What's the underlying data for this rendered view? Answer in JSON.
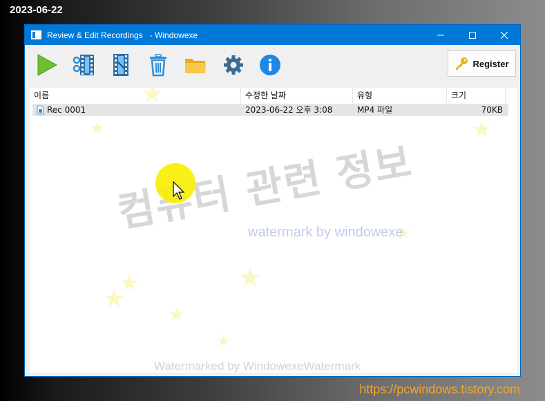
{
  "overlay": {
    "date": "2023-06-22",
    "url": "https://pcwindows.tistory.com"
  },
  "window": {
    "title": "Review & Edit Recordings   - Windowexe",
    "minimize_icon": "minimize-icon",
    "maximize_icon": "maximize-icon",
    "close_icon": "close-icon"
  },
  "toolbar": {
    "buttons": [
      {
        "icon": "play-icon"
      },
      {
        "icon": "film-join-icon"
      },
      {
        "icon": "film-cut-icon"
      },
      {
        "icon": "trash-icon"
      },
      {
        "icon": "folder-icon"
      },
      {
        "icon": "gear-icon"
      },
      {
        "icon": "info-icon"
      }
    ],
    "register_label": "Register",
    "register_icon": "key-icon"
  },
  "list": {
    "columns": [
      "이름",
      "수정한 날짜",
      "유형",
      "크기"
    ],
    "rows": [
      {
        "name": "Rec 0001",
        "modified": "2023-06-22 오후 3:08",
        "type": "MP4 파일",
        "size": "70KB"
      }
    ]
  },
  "watermarks": {
    "main": "컴퓨터 관련 정보",
    "sub": "watermark by windowexe",
    "bottom": "Watermarked by WindowexeWatermark"
  },
  "colors": {
    "titlebar": "#0078d7",
    "play": "#6fbf2e",
    "icon_blue": "#2f8fd8",
    "folder": "#f5b731",
    "gear": "#3d6a8f",
    "highlight": "#f8ee00",
    "url": "#f5a623"
  }
}
